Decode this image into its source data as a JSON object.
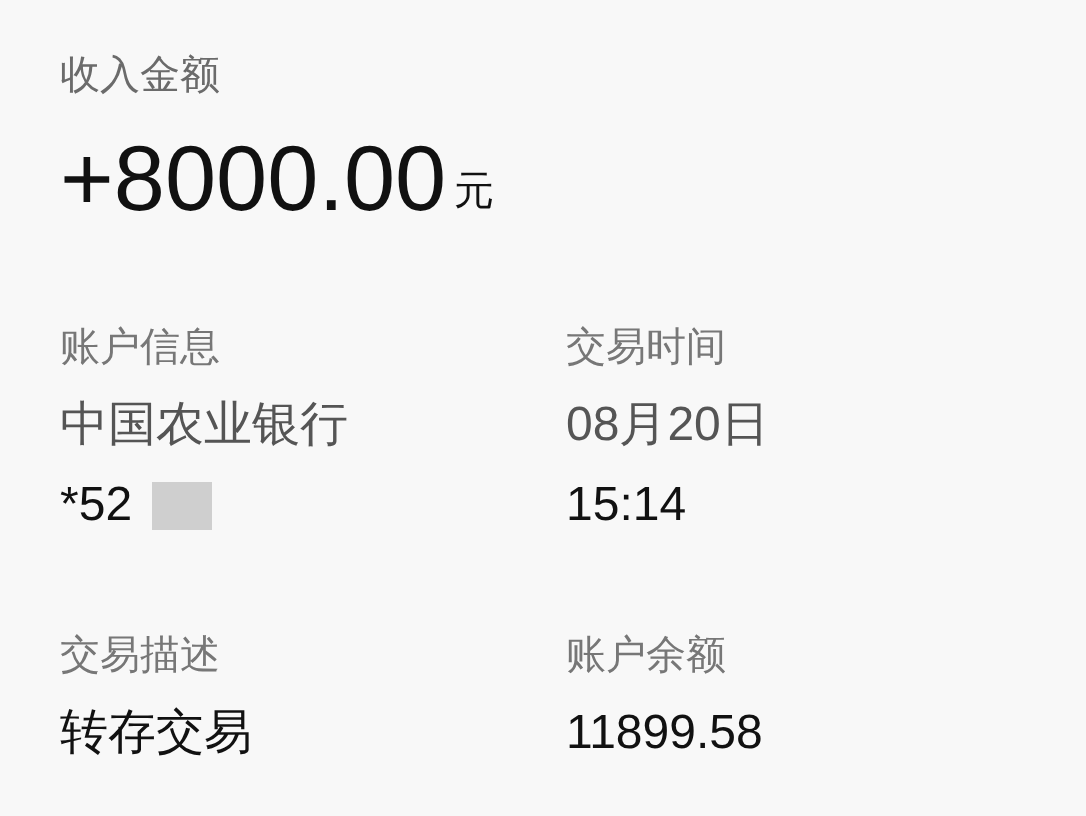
{
  "income": {
    "label": "收入金额",
    "sign_amount": "+8000.00",
    "unit": "元"
  },
  "details": [
    {
      "label": "账户信息",
      "lines": [
        "中国农业银行",
        "*52"
      ]
    },
    {
      "label": "交易时间",
      "lines": [
        "08月20日",
        "15:14"
      ]
    },
    {
      "label": "交易描述",
      "lines": [
        "转存交易"
      ]
    },
    {
      "label": "账户余额",
      "lines": [
        "11899.58"
      ]
    }
  ]
}
